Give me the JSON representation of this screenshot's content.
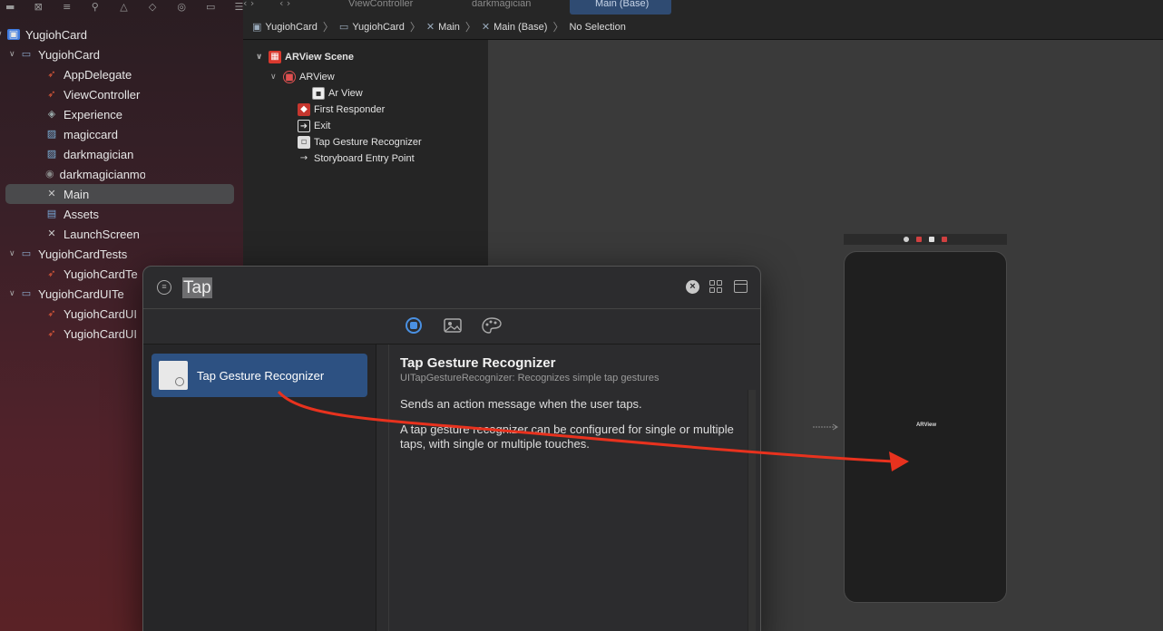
{
  "tabs": [
    "ViewController",
    "darkmagician",
    "Main (Base)"
  ],
  "jumpbar": {
    "crumbs": [
      "YugiohCard",
      "YugiohCard",
      "Main",
      "Main (Base)",
      "No Selection"
    ]
  },
  "navigator": {
    "items": [
      {
        "label": "YugiohCard",
        "icon": "project-icon"
      },
      {
        "label": "YugiohCard",
        "icon": "folder-icon"
      },
      {
        "label": "AppDelegate",
        "icon": "swift-file-icon"
      },
      {
        "label": "ViewController",
        "icon": "swift-file-icon"
      },
      {
        "label": "Experience",
        "icon": "reality-file-icon"
      },
      {
        "label": "magiccard",
        "icon": "image-icon"
      },
      {
        "label": "darkmagician",
        "icon": "image-icon"
      },
      {
        "label": "darkmagicianmodel",
        "icon": "model-icon"
      },
      {
        "label": "Main",
        "icon": "storyboard-icon"
      },
      {
        "label": "Assets",
        "icon": "asset-catalog-icon"
      },
      {
        "label": "LaunchScreen",
        "icon": "storyboard-icon"
      },
      {
        "label": "YugiohCardTests",
        "icon": "folder-icon"
      },
      {
        "label": "YugiohCardTe",
        "icon": "swift-file-icon"
      },
      {
        "label": "YugiohCardUITe",
        "icon": "folder-icon"
      },
      {
        "label": "YugiohCardUI",
        "icon": "swift-file-icon"
      },
      {
        "label": "YugiohCardUI",
        "icon": "swift-file-icon"
      }
    ]
  },
  "outline": {
    "items": [
      {
        "label": "ARView Scene",
        "icon": "scene-icon"
      },
      {
        "label": "ARView",
        "icon": "arview-controller-icon"
      },
      {
        "label": "Ar View",
        "icon": "view-icon"
      },
      {
        "label": "First Responder",
        "icon": "first-responder-icon"
      },
      {
        "label": "Exit",
        "icon": "exit-icon"
      },
      {
        "label": "Tap Gesture Recognizer",
        "icon": "gesture-icon"
      },
      {
        "label": "Storyboard Entry Point",
        "icon": "entry-arrow-icon"
      }
    ]
  },
  "canvas": {
    "device_label": "ARView"
  },
  "library": {
    "search_value": "Tap",
    "item_label": "Tap Gesture Recognizer",
    "detail": {
      "title": "Tap Gesture Recognizer",
      "subtitle": "UITapGestureRecognizer: Recognizes simple tap gestures",
      "p1": "Sends an action message when the user taps.",
      "p2": "A tap gesture recognizer can be configured for single or multiple taps, with single or multiple touches."
    }
  },
  "colors": {
    "selection": "#2d5182",
    "annotation_arrow": "#e8321e",
    "accent": "#4a90e2"
  }
}
